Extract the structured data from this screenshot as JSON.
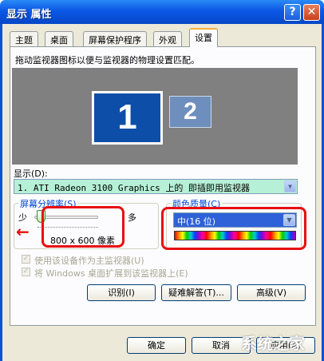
{
  "window": {
    "title": "显示 属性",
    "help_icon": "help-icon",
    "close_icon": "close-icon"
  },
  "tabs": [
    {
      "label": "主题"
    },
    {
      "label": "桌面"
    },
    {
      "label": "屏幕保护程序"
    },
    {
      "label": "外观"
    },
    {
      "label": "设置",
      "active": true
    }
  ],
  "settings": {
    "instruction": "拖动监视器图标以便与监视器的物理设置匹配。",
    "monitors": [
      {
        "number": "1",
        "selected": true
      },
      {
        "number": "2",
        "selected": false
      }
    ],
    "display_label": "显示(D):",
    "display_value": "1. ATI Radeon 3100 Graphics 上的 即插即用监视器",
    "resolution": {
      "title": "屏幕分辨率(S)",
      "less_label": "少",
      "more_label": "多",
      "value": "800 x 600 像素",
      "slider_position": 0.1
    },
    "color_quality": {
      "title": "颜色质量(C)",
      "selected": "中(16 位)"
    },
    "checkboxes": [
      {
        "label": "使用该设备作为主监视器(U)",
        "checked": true
      },
      {
        "label": "将 Windows 桌面扩展到该监视器上(E)",
        "checked": true
      }
    ],
    "buttons": {
      "identify": "识别(I)",
      "troubleshoot": "疑难解答(T)...",
      "advanced": "高级(V)"
    }
  },
  "footer": {
    "ok": "确定",
    "cancel": "取消",
    "apply": "应用(A)"
  },
  "watermark": "系统之家",
  "colors": {
    "title_blue": "#0a52d6",
    "annotation_red": "#e80e0e",
    "selection_blue": "#2f62d8",
    "display_select_bg": "#b6f0d6"
  }
}
